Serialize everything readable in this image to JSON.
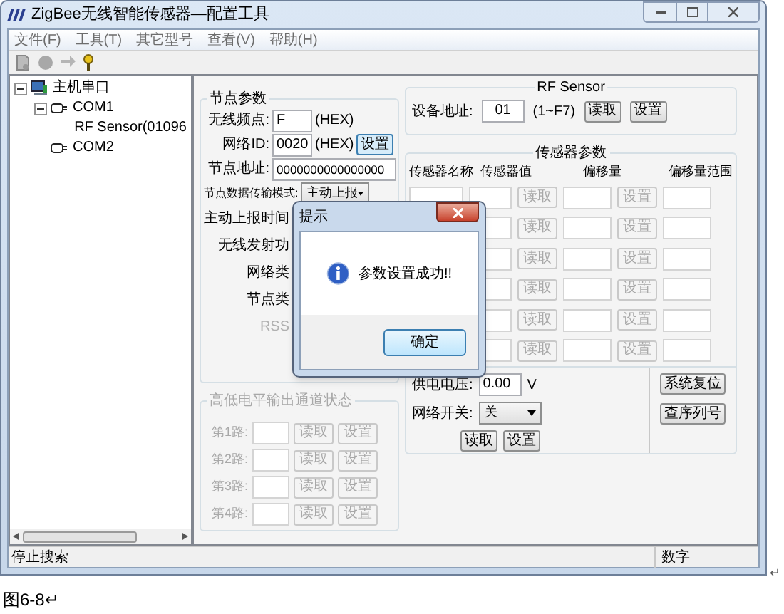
{
  "window": {
    "title": "ZigBee无线智能传感器—配置工具"
  },
  "menu": [
    "文件(F)",
    "工具(T)",
    "其它型号",
    "查看(V)",
    "帮助(H)"
  ],
  "tree": [
    {
      "label": "主机串口",
      "kind": "host",
      "expanded": true,
      "children": [
        {
          "label": "COM1",
          "kind": "port",
          "expanded": true,
          "children": [
            {
              "label": "RF Sensor(01096",
              "kind": "sensor"
            }
          ]
        },
        {
          "label": "COM2",
          "kind": "port"
        }
      ]
    }
  ],
  "node_params": {
    "title": "节点参数",
    "rows": [
      {
        "kind": "input",
        "label": "无线频点:",
        "value": "F",
        "unit": "(HEX)"
      },
      {
        "kind": "input",
        "label": "网络ID:",
        "value": "0020",
        "unit": "(HEX)",
        "button": "设置"
      },
      {
        "kind": "input",
        "label": "节点地址:",
        "value": "0000000000000000"
      },
      {
        "kind": "select",
        "label": "节点数据传输模式:",
        "value": "主动上报"
      },
      {
        "kind": "label",
        "label": "主动上报时间"
      },
      {
        "kind": "label",
        "label": "无线发射功"
      },
      {
        "kind": "label",
        "label": "网络类"
      },
      {
        "kind": "label",
        "label": "节点类"
      },
      {
        "kind": "label",
        "label": "RSS",
        "disabled": true
      }
    ]
  },
  "channels": {
    "title": "高低电平输出通道状态",
    "disabled": true,
    "rows": [
      {
        "label": "第1路:",
        "read": "读取",
        "set": "设置"
      },
      {
        "label": "第2路:",
        "read": "读取",
        "set": "设置"
      },
      {
        "label": "第3路:",
        "read": "读取",
        "set": "设置"
      },
      {
        "label": "第4路:",
        "read": "读取",
        "set": "设置"
      }
    ]
  },
  "rf_sensor": {
    "title": "RF Sensor",
    "label": "设备地址:",
    "value": "01",
    "range": "(1~F7)",
    "read": "读取",
    "set": "设置"
  },
  "sensor_params": {
    "title": "传感器参数",
    "columns": [
      "传感器名称",
      "传感器值",
      "偏移量",
      "偏移量范围"
    ],
    "rows": [
      {
        "read": "读取",
        "set": "设置",
        "disabled": true
      },
      {
        "read": "读取",
        "set": "设置",
        "disabled": true
      },
      {
        "read": "读取",
        "set": "设置",
        "disabled": true
      },
      {
        "read": "读取",
        "set": "设置",
        "disabled": true
      },
      {
        "read": "读取",
        "set": "设置",
        "disabled": true
      },
      {
        "read": "读取",
        "set": "设置",
        "disabled": true
      }
    ]
  },
  "power": {
    "voltage_label": "供电电压:",
    "voltage": "0.00",
    "unit": "V",
    "switch_label": "网络开关:",
    "switch_value": "关",
    "read": "读取",
    "set": "设置"
  },
  "system_buttons": [
    "系统复位",
    "查序列号"
  ],
  "dialog": {
    "title": "提示",
    "message": "参数设置成功!!",
    "ok": "确定"
  },
  "status_bar": {
    "left": "停止搜索",
    "right": "数字"
  },
  "caption": "图6-8↵",
  "corner_mark": "↵"
}
